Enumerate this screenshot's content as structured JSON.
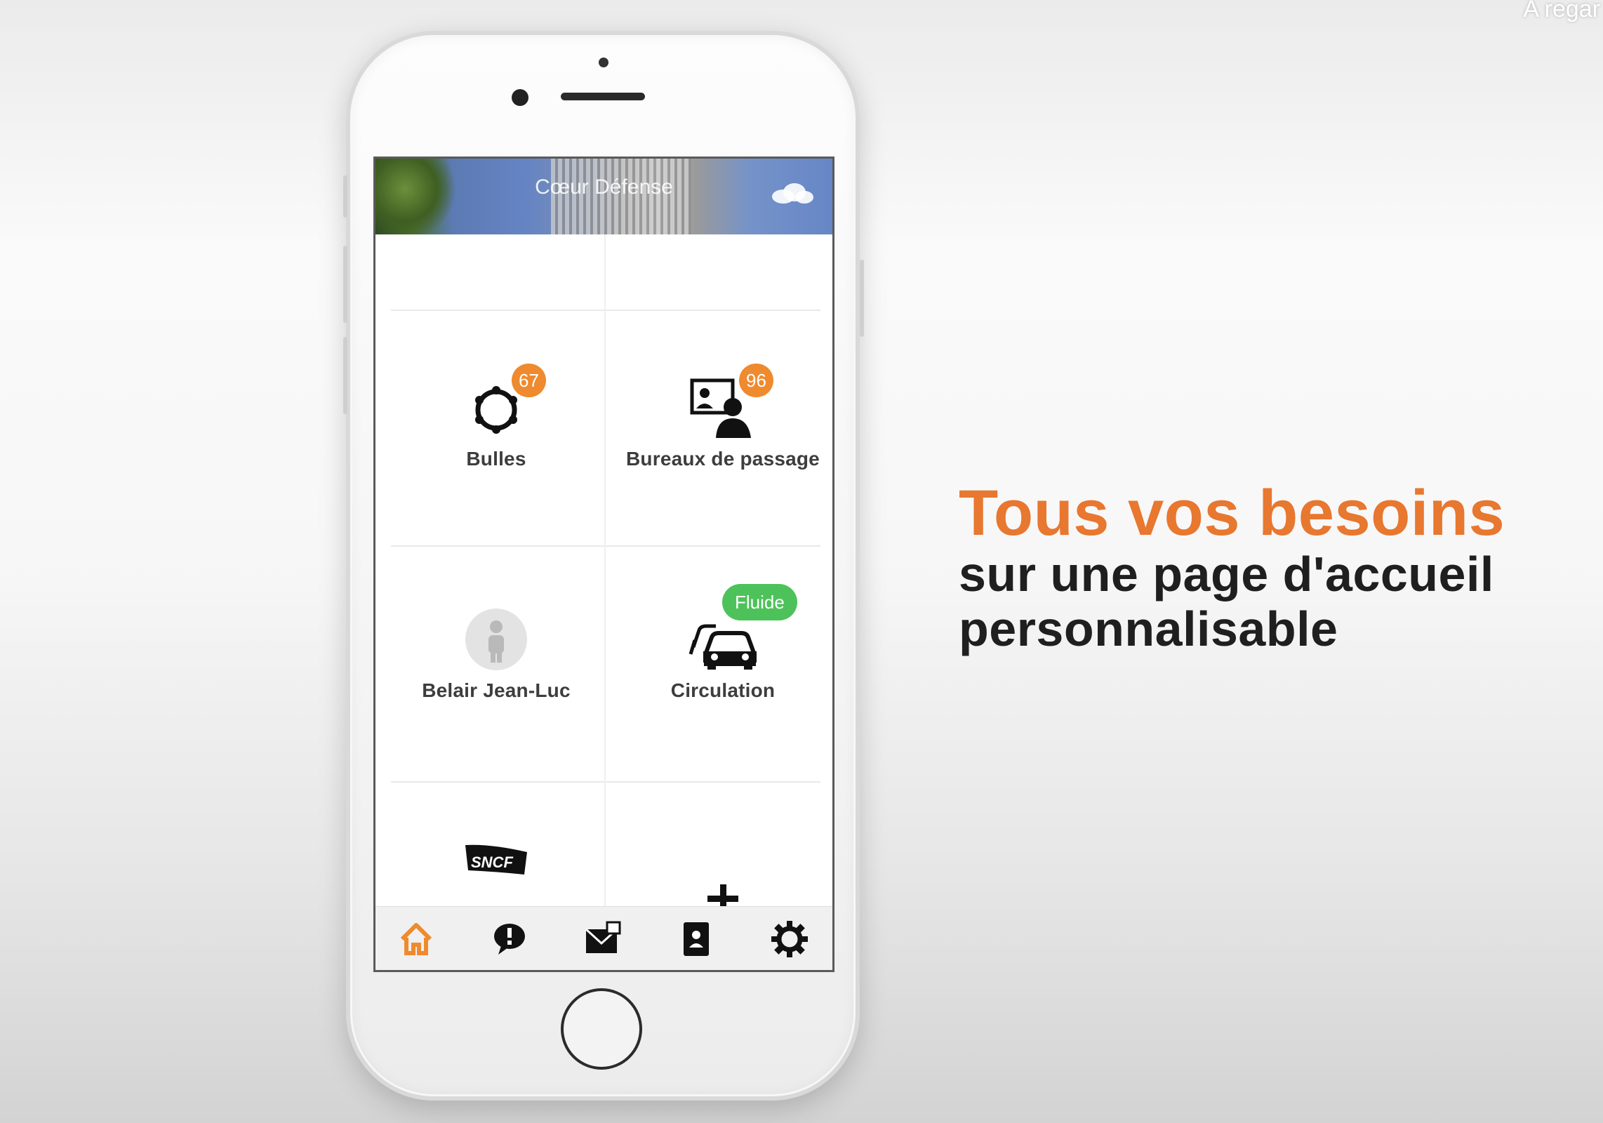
{
  "overlay": {
    "corner_text": "A regar"
  },
  "app": {
    "location_title": "Cœur Défense",
    "tiles": [
      {
        "label": "Bulles",
        "badge": "67",
        "icon": "gear-network-icon"
      },
      {
        "label": "Bureaux de passage",
        "badge": "96",
        "icon": "office-people-icon"
      },
      {
        "label": "Belair Jean-Luc",
        "badge": "",
        "icon": "user-avatar-icon"
      },
      {
        "label": "Circulation",
        "badge": "Fluide",
        "icon": "traffic-cars-icon"
      },
      {
        "label": "",
        "badge": "",
        "icon": "sncf-logo-icon",
        "logo_text": "SNCF"
      },
      {
        "label": "",
        "badge": "",
        "icon": "add-icon"
      }
    ],
    "tabbar": [
      "home-icon",
      "alert-bubble-icon",
      "mail-photo-icon",
      "contact-book-icon",
      "settings-gear-icon"
    ]
  },
  "promo": {
    "heading": "Tous vos besoins",
    "line1": "sur une page d'accueil",
    "line2": "personnalisable"
  },
  "colors": {
    "accent_orange": "#e8772f",
    "badge_orange": "#ef8a2e",
    "badge_green": "#4ec25a"
  }
}
